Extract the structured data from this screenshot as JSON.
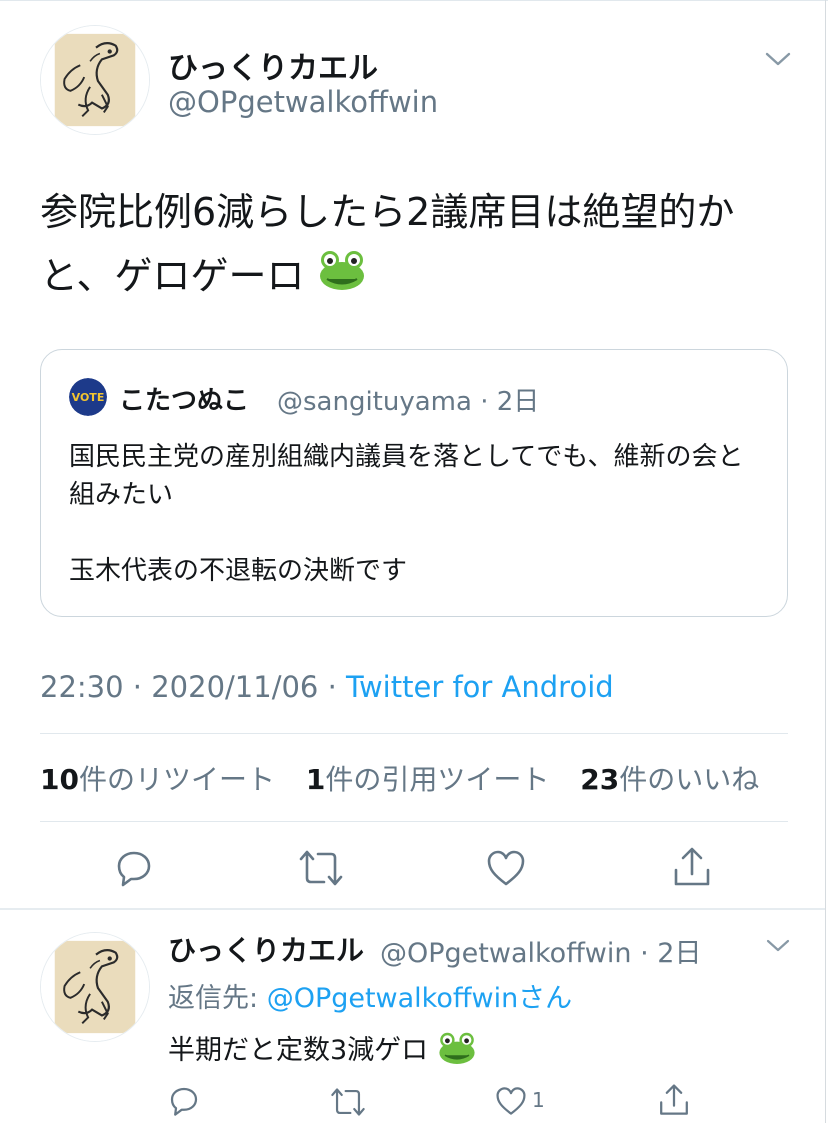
{
  "tweet": {
    "author_name": "ひっくりカエル",
    "author_handle": "@OPgetwalkoffwin",
    "text": "参院比例6減らしたら2議席目は絶望的かと、ゲロゲーロ",
    "emoji": "frog-face",
    "quote": {
      "author_name": "こたつぬこ",
      "author_handle": "@sangituyama",
      "time": "2日",
      "text": "国民民主党の産別組織内議員を落としてでも、維新の会と組みたい\n\n玉木代表の不退転の決断です"
    },
    "time": "22:30",
    "date": "2020/11/06",
    "source": "Twitter for Android",
    "stats": {
      "retweets_count": "10",
      "retweets_label": "件のリツイート",
      "quotes_count": "1",
      "quotes_label": "件の引用ツイート",
      "likes_count": "23",
      "likes_label": "件のいいね"
    }
  },
  "reply": {
    "author_name": "ひっくりカエル",
    "author_handle": "@OPgetwalkoffwin",
    "time": "2日",
    "reply_to_label": "返信先: ",
    "reply_to_handle": "@OPgetwalkoffwinさん",
    "text": "半期だと定数3減ゲロ",
    "emoji": "frog-face",
    "like_count": "1"
  },
  "colors": {
    "accent": "#1da1f2",
    "secondary_text": "#657786",
    "primary_text": "#14171a",
    "border": "#e1e8ed"
  }
}
